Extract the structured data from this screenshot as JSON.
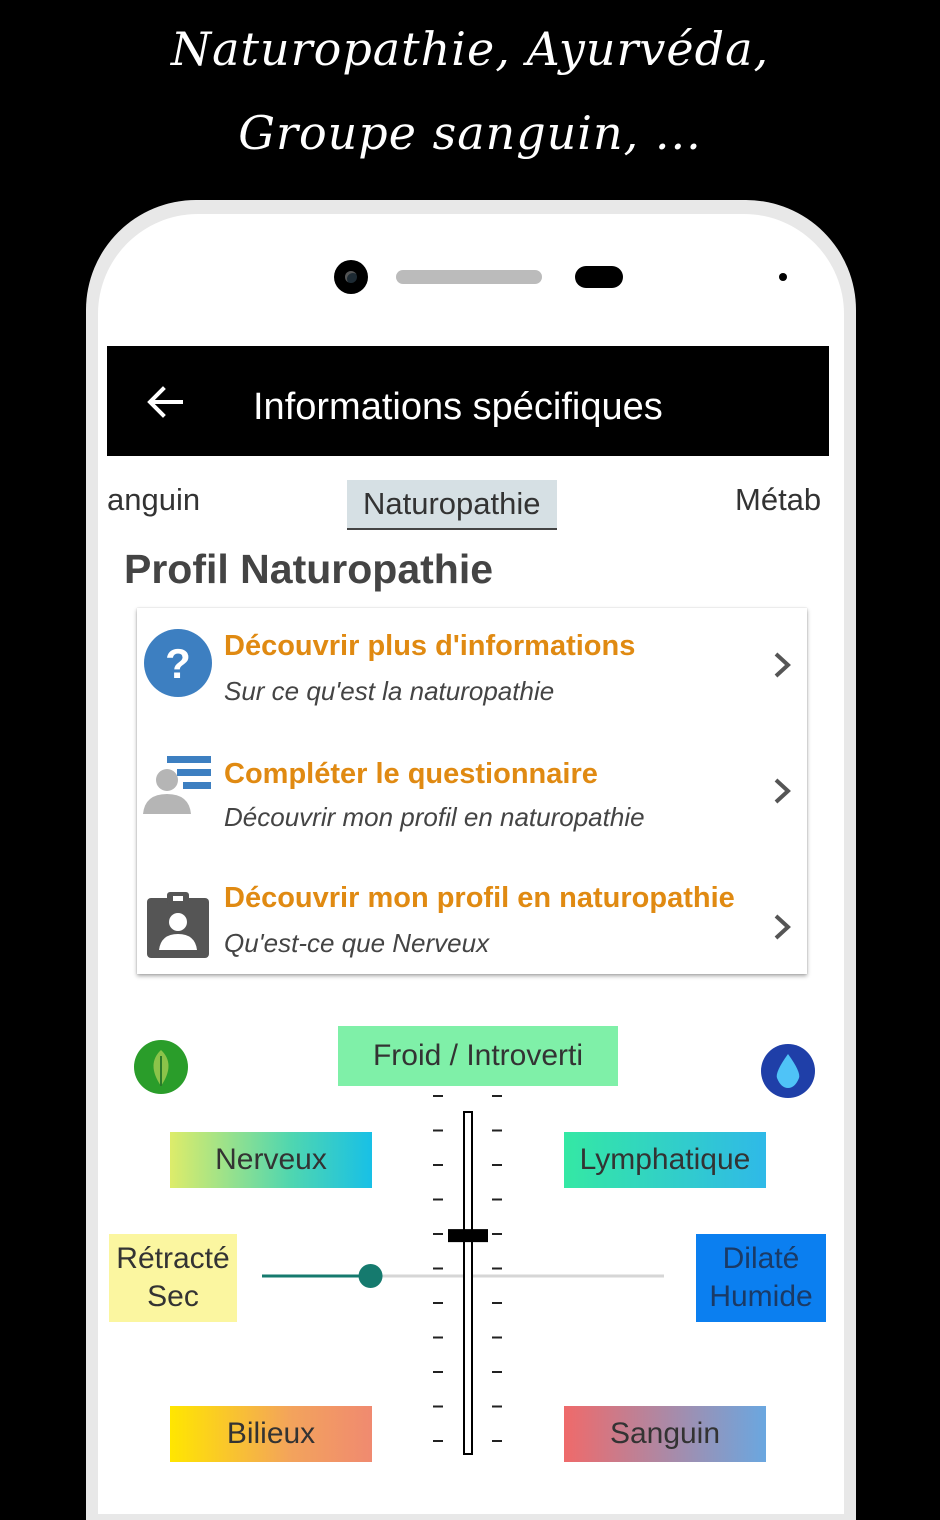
{
  "promo": {
    "line1": "Naturopathie, Ayurvéda,",
    "line2": "Groupe sanguin, ..."
  },
  "appbar": {
    "title": "Informations spécifiques",
    "back_icon": "arrow-left-icon"
  },
  "tabs": {
    "prev": "anguin",
    "active": "Naturopathie",
    "next": "Métab"
  },
  "section_title": "Profil Naturopathie",
  "menu": [
    {
      "title": "Découvrir plus d'informations",
      "subtitle": "Sur ce qu'est la naturopathie",
      "icon": "question-circle-icon"
    },
    {
      "title": "Compléter le questionnaire",
      "subtitle": "Découvrir mon profil en naturopathie",
      "icon": "user-list-icon"
    },
    {
      "title": "Découvrir mon profil en naturopathie",
      "subtitle": "Qu'est-ce que Nerveux",
      "icon": "clipboard-user-icon"
    }
  ],
  "profile": {
    "top_label": "Froid / Introverti",
    "nerveux": "Nerveux",
    "lymphatique": "Lymphatique",
    "left_label_1": "Rétracté",
    "left_label_2": "Sec",
    "right_label_1": "Dilaté",
    "right_label_2": "Humide",
    "bilieux": "Bilieux",
    "sanguin": "Sanguin",
    "horizontal_slider_value": 0.27,
    "vertical_slider_value": 0.36
  },
  "colors": {
    "accent_orange": "#e08a12",
    "question_blue": "#3d7fc1",
    "slider_teal": "#157a6e",
    "appbar": "#000000"
  }
}
